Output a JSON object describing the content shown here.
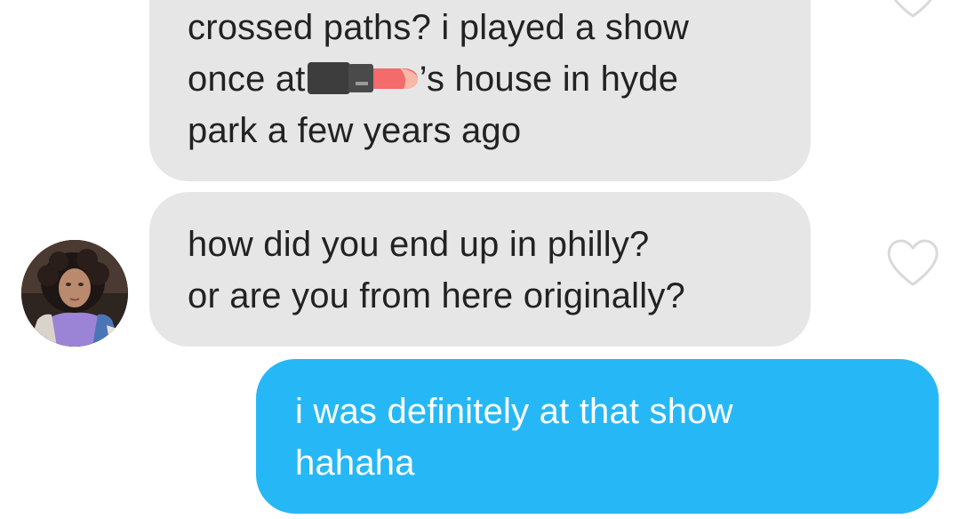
{
  "conversation": {
    "messages": [
      {
        "sender": "them",
        "lines": [
          "crossed paths? i played a show",
          "once at",
          "’s house in hyde",
          "park a few years ago"
        ]
      },
      {
        "sender": "them",
        "lines": [
          "how did you end up in philly?",
          "or are you from here originally?"
        ]
      },
      {
        "sender": "me",
        "lines": [
          "i was definitely at that show",
          "hahaha"
        ]
      }
    ]
  },
  "colors": {
    "incoming_bubble": "#e6e6e6",
    "outgoing_bubble": "#26b8f6",
    "incoming_text": "#222222",
    "outgoing_text": "#ffffff",
    "heart_outline": "#d9d9d9"
  },
  "icons": {
    "like": "heart-outline-icon",
    "redaction": "lipstick-sticker"
  }
}
